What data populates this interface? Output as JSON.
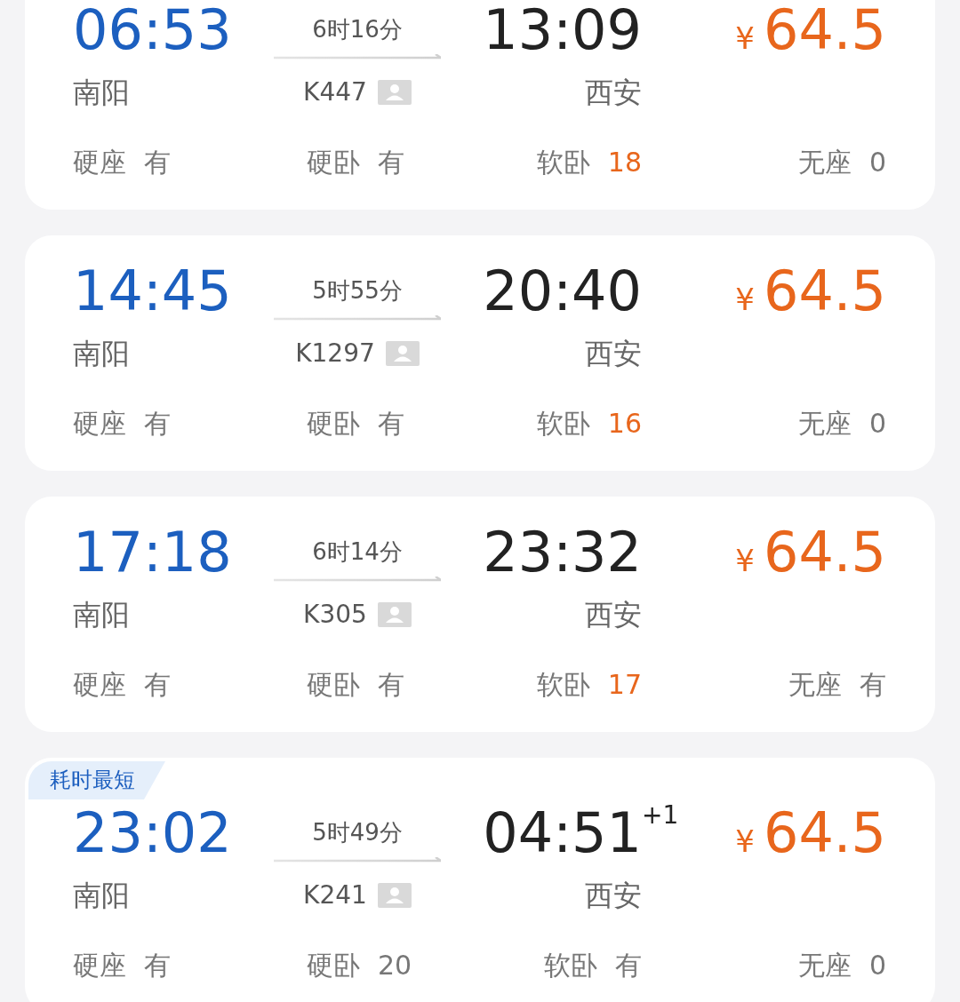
{
  "trains": [
    {
      "depart_time": "06:53",
      "depart_station": "南阳",
      "duration": "6时16分",
      "train_no": "K447",
      "arrive_time": "13:09",
      "arrive_station": "西安",
      "currency": "¥",
      "price": "64.5",
      "seats": [
        {
          "name": "硬座",
          "value": "有",
          "highlight": false
        },
        {
          "name": "硬卧",
          "value": "有",
          "highlight": false
        },
        {
          "name": "软卧",
          "value": "18",
          "highlight": true
        },
        {
          "name": "无座",
          "value": "0",
          "highlight": false
        }
      ]
    },
    {
      "depart_time": "14:45",
      "depart_station": "南阳",
      "duration": "5时55分",
      "train_no": "K1297",
      "arrive_time": "20:40",
      "arrive_station": "西安",
      "currency": "¥",
      "price": "64.5",
      "seats": [
        {
          "name": "硬座",
          "value": "有",
          "highlight": false
        },
        {
          "name": "硬卧",
          "value": "有",
          "highlight": false
        },
        {
          "name": "软卧",
          "value": "16",
          "highlight": true
        },
        {
          "name": "无座",
          "value": "0",
          "highlight": false
        }
      ]
    },
    {
      "depart_time": "17:18",
      "depart_station": "南阳",
      "duration": "6时14分",
      "train_no": "K305",
      "arrive_time": "23:32",
      "arrive_station": "西安",
      "currency": "¥",
      "price": "64.5",
      "seats": [
        {
          "name": "硬座",
          "value": "有",
          "highlight": false
        },
        {
          "name": "硬卧",
          "value": "有",
          "highlight": false
        },
        {
          "name": "软卧",
          "value": "17",
          "highlight": true
        },
        {
          "name": "无座",
          "value": "有",
          "highlight": false
        }
      ]
    },
    {
      "tag": "耗时最短",
      "depart_time": "23:02",
      "depart_station": "南阳",
      "duration": "5时49分",
      "train_no": "K241",
      "arrive_time": "04:51",
      "day_offset": "+1",
      "arrive_station": "西安",
      "currency": "¥",
      "price": "64.5",
      "seats": [
        {
          "name": "硬座",
          "value": "有",
          "highlight": false
        },
        {
          "name": "硬卧",
          "value": "20",
          "highlight": false
        },
        {
          "name": "软卧",
          "value": "有",
          "highlight": false
        },
        {
          "name": "无座",
          "value": "0",
          "highlight": false
        }
      ]
    }
  ]
}
